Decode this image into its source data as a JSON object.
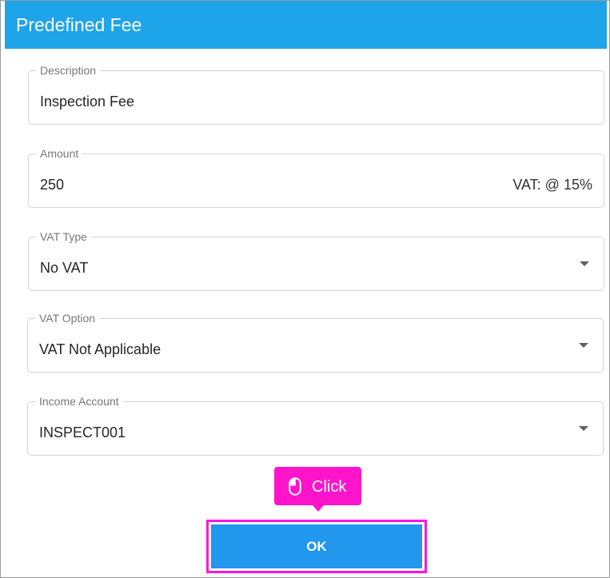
{
  "dialog": {
    "title": "Predefined Fee"
  },
  "fields": {
    "description": {
      "label": "Description",
      "value": "Inspection Fee"
    },
    "amount": {
      "label": "Amount",
      "value": "250",
      "suffix": "VAT: @ 15%"
    },
    "vat_type": {
      "label": "VAT Type",
      "value": "No VAT",
      "icon": "dropdown-caret-icon"
    },
    "vat_option": {
      "label": "VAT Option",
      "value": "VAT Not Applicable",
      "icon": "dropdown-caret-icon"
    },
    "income_account": {
      "label": "Income Account",
      "value": "INSPECT001",
      "icon": "dropdown-caret-icon"
    }
  },
  "tooltip": {
    "text": "Click",
    "icon": "mouse-icon",
    "color": "#ff14cc"
  },
  "actions": {
    "ok_label": "OK"
  },
  "colors": {
    "header": "#1ea4e9",
    "ok_button": "#2197ee",
    "highlight": "#ff14e6"
  }
}
